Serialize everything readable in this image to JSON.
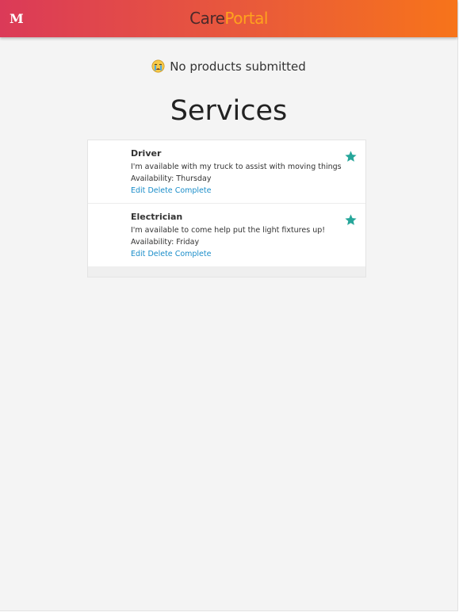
{
  "header": {
    "logo_letter": "M",
    "brand_part1": "Care",
    "brand_part2": "Portal",
    "gradient_colors": [
      "#db3a58",
      "#f7741a"
    ],
    "portal_color": "#ffa21e"
  },
  "notice": {
    "icon": "crying-face-emoji",
    "text": "No products submitted"
  },
  "services_heading": "Services",
  "services": [
    {
      "title": "Driver",
      "description": "I'm available with my truck to assist with moving things",
      "availability": "Availability: Thursday",
      "actions": [
        "Edit",
        "Delete",
        "Complete"
      ],
      "icon": "star-icon"
    },
    {
      "title": "Electrician",
      "description": "I'm available to come help put the light fixtures up!",
      "availability": "Availability: Friday",
      "actions": [
        "Edit",
        "Delete",
        "Complete"
      ],
      "icon": "star-icon"
    }
  ],
  "colors": {
    "star": "#26a69a",
    "link": "#1a8dc9"
  }
}
